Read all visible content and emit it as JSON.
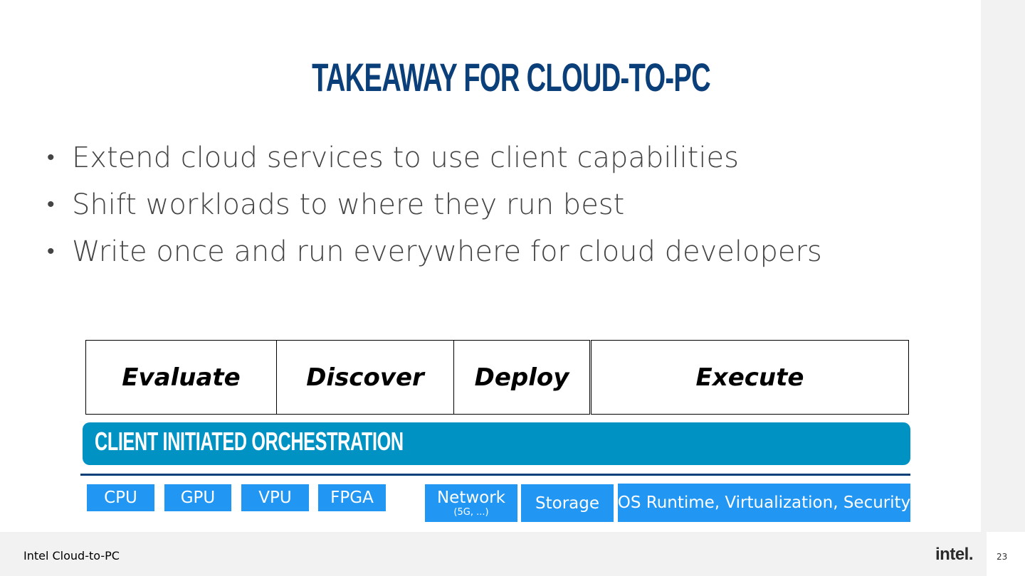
{
  "slide": {
    "title": "TAKEAWAY FOR CLOUD-TO-PC",
    "bullets": [
      "Extend cloud services to use client capabilities",
      "Shift workloads to where they run best",
      "Write once and run everywhere for cloud developers"
    ]
  },
  "diagram": {
    "phases": [
      "Evaluate",
      "Discover",
      "Deploy",
      "Execute"
    ],
    "orchestration_label": "CLIENT INITIATED ORCHESTRATION",
    "capabilities": [
      {
        "label": "CPU"
      },
      {
        "label": "GPU"
      },
      {
        "label": "VPU"
      },
      {
        "label": "FPGA"
      },
      {
        "label": "Network",
        "sub": "(5G, ...)"
      },
      {
        "label": "Storage"
      },
      {
        "label": "OS Runtime, Virtualization, Security"
      }
    ],
    "colors": {
      "title": "#0b3f7a",
      "orchestration_bar": "#0092c3",
      "capability_box": "#2196f3",
      "rule": "#0b3f7a"
    }
  },
  "footer": {
    "text": "Intel Cloud-to-PC",
    "logo": "intel.",
    "page_number": "23"
  }
}
